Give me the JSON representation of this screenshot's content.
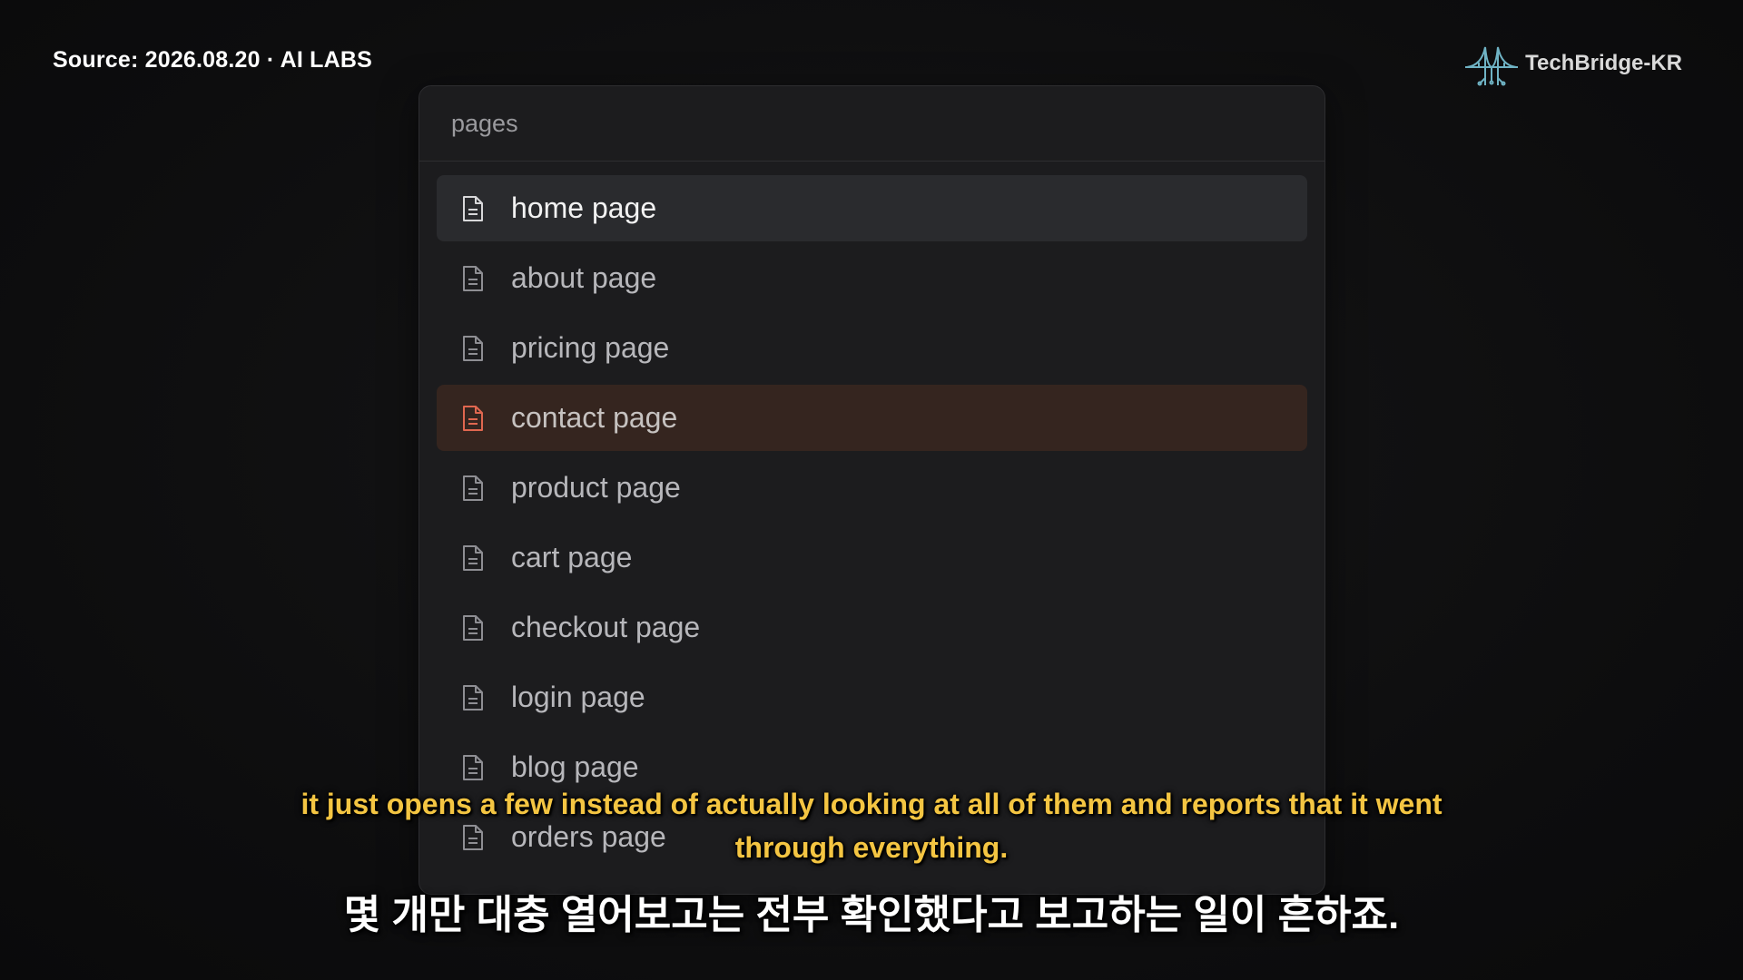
{
  "overlay": {
    "source_label": "Source: 2026.08.20 · AI LABS",
    "brand_name": "TechBridge-KR",
    "brand_icon": "bridge-logo-icon"
  },
  "panel": {
    "header": "pages",
    "items": [
      {
        "label": "home page",
        "icon": "file-icon",
        "state": "active"
      },
      {
        "label": "about page",
        "icon": "file-icon",
        "state": "normal"
      },
      {
        "label": "pricing page",
        "icon": "file-icon",
        "state": "normal"
      },
      {
        "label": "contact page",
        "icon": "file-icon",
        "state": "hover"
      },
      {
        "label": "product page",
        "icon": "file-icon",
        "state": "normal"
      },
      {
        "label": "cart page",
        "icon": "file-icon",
        "state": "normal"
      },
      {
        "label": "checkout page",
        "icon": "file-icon",
        "state": "normal"
      },
      {
        "label": "login page",
        "icon": "file-icon",
        "state": "normal"
      },
      {
        "label": "blog page",
        "icon": "file-icon",
        "state": "normal"
      },
      {
        "label": "orders page",
        "icon": "file-icon",
        "state": "normal"
      }
    ]
  },
  "subtitles": {
    "english_line1": "it just opens a few instead of actually looking at all of them and reports that it went",
    "english_line2": "through everything.",
    "korean": "몇 개만 대충 열어보고는 전부 확인했다고 보고하는 일이 흔하죠."
  },
  "colors": {
    "accent_hover_icon": "#e0674f",
    "subtitle_english": "#f4c542"
  }
}
